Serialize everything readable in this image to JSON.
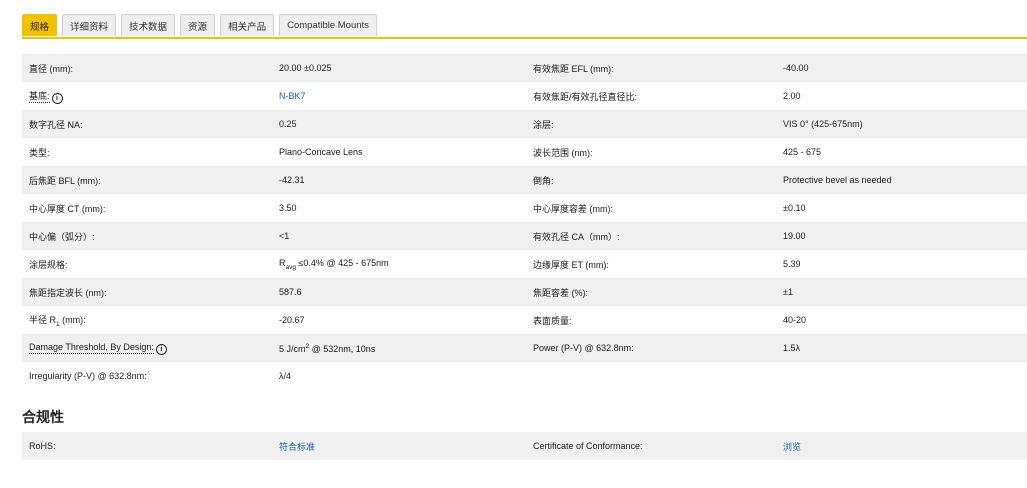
{
  "tabs": [
    {
      "label": "规格",
      "active": true
    },
    {
      "label": "详细资料",
      "active": false
    },
    {
      "label": "技术数据",
      "active": false
    },
    {
      "label": "资源",
      "active": false
    },
    {
      "label": "相关产品",
      "active": false
    },
    {
      "label": "Compatible Mounts",
      "active": false
    }
  ],
  "specs": {
    "r0": {
      "l1": "直径 (mm):",
      "v1": "20.00 ±0.025",
      "l2": "有效焦距 EFL (mm):",
      "v2": "-40.00"
    },
    "r1": {
      "l1": "基底:",
      "v1": "N-BK7",
      "l2": "有效焦距/有效孔径直径比:",
      "v2": "2.00"
    },
    "r2": {
      "l1": "数字孔径 NA:",
      "v1": "0.25",
      "l2": "涂层:",
      "v2": "VIS 0° (425-675nm)"
    },
    "r3": {
      "l1": "类型:",
      "v1": "Plano-Concave Lens",
      "l2": "波长范围 (nm):",
      "v2": "425 - 675"
    },
    "r4": {
      "l1": "后焦距 BFL (mm):",
      "v1": "-42.31",
      "l2": "倒角:",
      "v2": "Protective bevel as needed"
    },
    "r5": {
      "l1": "中心厚度 CT (mm):",
      "v1": "3.50",
      "l2": "中心厚度容差 (mm):",
      "v2": "±0.10"
    },
    "r6": {
      "l1": "中心偏（弧分）:",
      "v1": "<1",
      "l2": "有效孔径 CA（mm）:",
      "v2": "19.00"
    },
    "r7": {
      "l1": "涂层规格:",
      "v1_pre": "R",
      "v1_sub": "avg",
      "v1_post": " ≤0.4% @ 425 - 675nm",
      "l2": "边缘厚度 ET (mm):",
      "v2": "5.39"
    },
    "r8": {
      "l1": "焦距指定波长 (nm):",
      "v1": "587.6",
      "l2": "焦距容差 (%):",
      "v2": "±1"
    },
    "r9": {
      "l1_pre": "半径 R",
      "l1_sub": "1",
      "l1_post": " (mm):",
      "v1": "-20.67",
      "l2": "表面质量:",
      "v2": "40-20"
    },
    "r10": {
      "l1": "Damage Threshold, By Design:",
      "v1_pre": "5 J/cm",
      "v1_sup": "2",
      "v1_post": " @ 532nm, 10ns",
      "l2": "Power (P-V) @ 632.8nm:",
      "v2": "1.5λ"
    },
    "r11": {
      "l1": "Irregularity (P-V) @ 632.8nm:",
      "v1": "λ/4"
    }
  },
  "compliance": {
    "heading": "合规性",
    "rohs_label": "RoHS:",
    "rohs_value": "符合标准",
    "coc_label": "Certificate of Conformance:",
    "coc_value": "浏览"
  },
  "icons": {
    "info": "i"
  },
  "colors": {
    "accent": "#f2c200",
    "link": "#1f5fa8",
    "row_shade": "#f0f0f0"
  }
}
